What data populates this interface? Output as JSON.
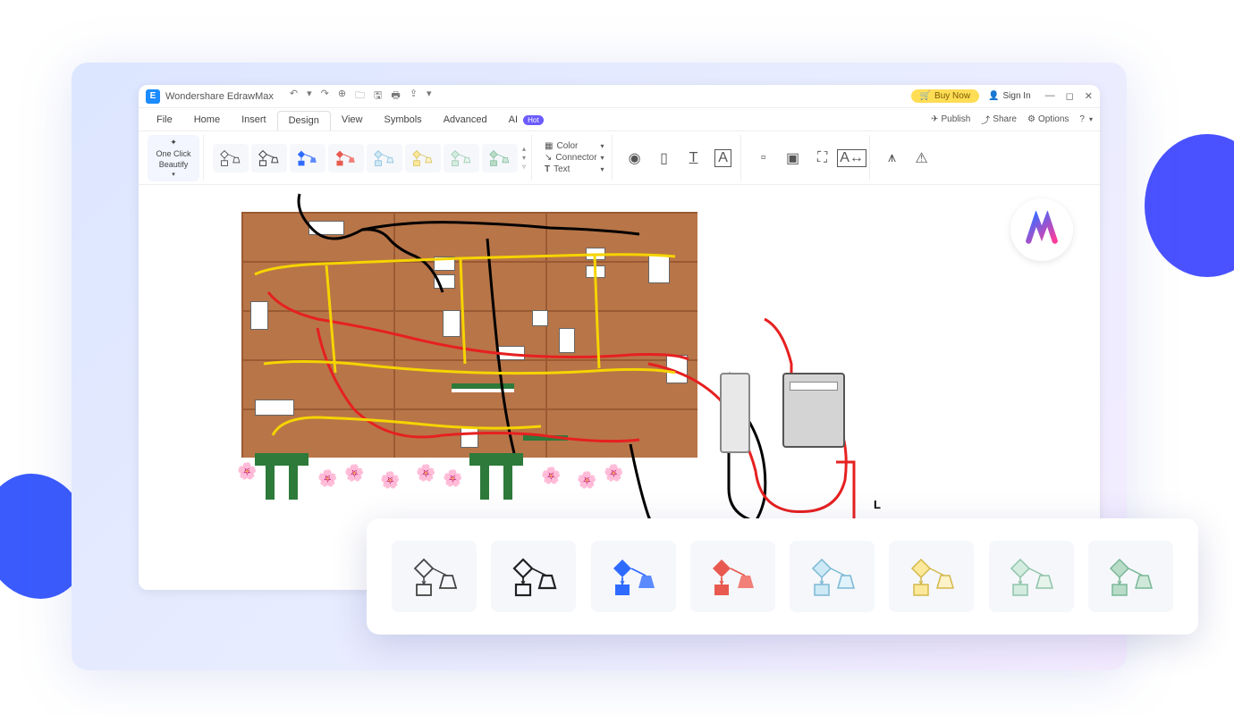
{
  "titlebar": {
    "appName": "Wondershare EdrawMax",
    "buyLabel": "Buy Now",
    "signInLabel": "Sign In"
  },
  "menu": {
    "tabs": [
      "File",
      "Home",
      "Insert",
      "Design",
      "View",
      "Symbols",
      "Advanced",
      "AI"
    ],
    "activeTab": "Design",
    "hotBadge": "Hot",
    "rightActions": {
      "publish": "Publish",
      "share": "Share",
      "options": "Options"
    }
  },
  "ribbon": {
    "beautifyLabel1": "One Click",
    "beautifyLabel2": "Beautify",
    "colorLabel": "Color",
    "connectorLabel": "Connector",
    "textLabel": "Text",
    "styleColors": [
      "#444",
      "#444",
      "#2f6bff",
      "#e85a4f",
      "#a7d8ef",
      "#f5d95a",
      "#bfe4d6",
      "#a0d4bb"
    ]
  },
  "canvas": {
    "wiringLabel": "L",
    "wireColors": {
      "black": "#000",
      "red": "#e62020",
      "yellow": "#f5d400"
    }
  },
  "palette": {
    "colors": [
      "#444",
      "#444",
      "#2f6bff",
      "#e85a4f",
      "#a7d8ef",
      "#f5d95a",
      "#bfe4d6",
      "#a0d4bb"
    ]
  }
}
